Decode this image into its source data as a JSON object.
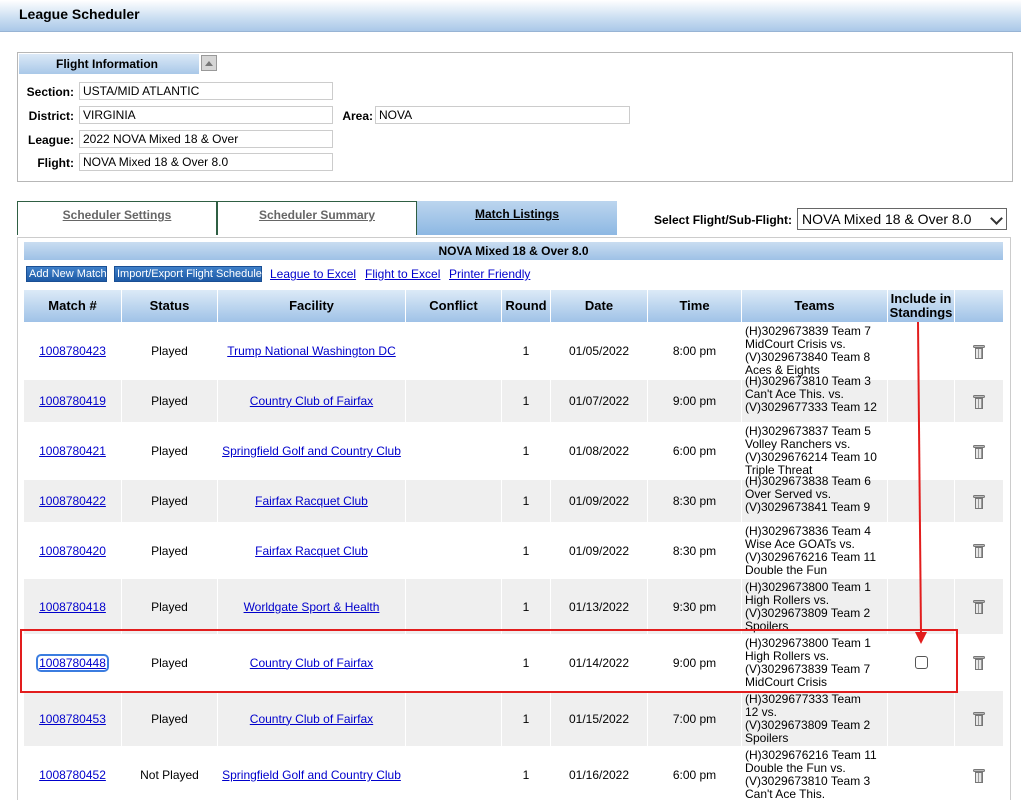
{
  "header": {
    "title": "League Scheduler"
  },
  "flight_info": {
    "tab_label": "Flight Information",
    "fields": {
      "section": {
        "label": "Section:",
        "value": "USTA/MID ATLANTIC"
      },
      "district": {
        "label": "District:",
        "value": "VIRGINIA"
      },
      "area": {
        "label": "Area:",
        "value": "NOVA"
      },
      "league": {
        "label": "League:",
        "value": "2022 NOVA Mixed 18 & Over"
      },
      "flight": {
        "label": "Flight:",
        "value": "NOVA Mixed 18 & Over 8.0"
      }
    }
  },
  "tabs": [
    {
      "label": "Scheduler Settings"
    },
    {
      "label": "Scheduler Summary"
    },
    {
      "label": "Match Listings",
      "active": true
    }
  ],
  "select_flight": {
    "label": "Select Flight/Sub-Flight:",
    "value": "NOVA Mixed 18 & Over 8.0"
  },
  "flight_title": "NOVA Mixed 18 & Over 8.0",
  "actions": {
    "add_new_match": "Add New Match",
    "import_export": "Import/Export Flight Schedule",
    "league_to_excel": "League to Excel",
    "flight_to_excel": "Flight to Excel",
    "printer_friendly": "Printer Friendly"
  },
  "table": {
    "headers": {
      "match": "Match #",
      "status": "Status",
      "facility": "Facility",
      "conflict": "Conflict",
      "round": "Round",
      "date": "Date",
      "time": "Time",
      "teams": "Teams",
      "include": "Include in Standings"
    },
    "rows": [
      {
        "match": "1008780423",
        "status": "Played",
        "facility": "Trump National Washington DC",
        "conflict": "",
        "round": "1",
        "date": "01/05/2022",
        "time": "8:00 pm",
        "teams": [
          "(H)3029673839 Team 7",
          "MidCourt Crisis vs.",
          "(V)3029673840 Team 8",
          "Aces & Eights"
        ]
      },
      {
        "match": "1008780419",
        "status": "Played",
        "facility": "Country Club of Fairfax",
        "conflict": "",
        "round": "1",
        "date": "01/07/2022",
        "time": "9:00 pm",
        "teams": [
          "(H)3029673810 Team 3",
          "Can't Ace This. vs.",
          "(V)3029677333 Team 12",
          ""
        ]
      },
      {
        "match": "1008780421",
        "status": "Played",
        "facility": "Springfield Golf and Country Club",
        "conflict": "",
        "round": "1",
        "date": "01/08/2022",
        "time": "6:00 pm",
        "teams": [
          "(H)3029673837 Team 5",
          "Volley Ranchers vs.",
          "(V)3029676214 Team 10",
          "Triple Threat"
        ]
      },
      {
        "match": "1008780422",
        "status": "Played",
        "facility": "Fairfax Racquet Club",
        "conflict": "",
        "round": "1",
        "date": "01/09/2022",
        "time": "8:30 pm",
        "teams": [
          "(H)3029673838 Team 6",
          "Over Served vs.",
          "(V)3029673841 Team 9",
          ""
        ]
      },
      {
        "match": "1008780420",
        "status": "Played",
        "facility": "Fairfax Racquet Club",
        "conflict": "",
        "round": "1",
        "date": "01/09/2022",
        "time": "8:30 pm",
        "teams": [
          "(H)3029673836 Team 4",
          "Wise Ace GOATs vs.",
          "(V)3029676216 Team 11",
          "Double the Fun"
        ]
      },
      {
        "match": "1008780418",
        "status": "Played",
        "facility": "Worldgate Sport & Health",
        "conflict": "",
        "round": "1",
        "date": "01/13/2022",
        "time": "9:30 pm",
        "teams": [
          "(H)3029673800 Team 1",
          "High Rollers vs.",
          "(V)3029673809 Team 2",
          "Spoilers"
        ]
      },
      {
        "match": "1008780448",
        "status": "Played",
        "facility": "Country Club of Fairfax",
        "conflict": "",
        "round": "1",
        "date": "01/14/2022",
        "time": "9:00 pm",
        "teams": [
          "(H)3029673800 Team 1",
          "High Rollers vs.",
          "(V)3029673839 Team 7",
          "MidCourt Crisis"
        ]
      },
      {
        "match": "1008780453",
        "status": "Played",
        "facility": "Country Club of Fairfax",
        "conflict": "",
        "round": "1",
        "date": "01/15/2022",
        "time": "7:00 pm",
        "teams": [
          "(H)3029677333 Team",
          "12 vs.",
          "(V)3029673809 Team 2",
          "Spoilers"
        ]
      },
      {
        "match": "1008780452",
        "status": "Not Played",
        "facility": "Springfield Golf and Country Club",
        "conflict": "",
        "round": "1",
        "date": "01/16/2022",
        "time": "6:00 pm",
        "teams": [
          "(H)3029676216 Team 11",
          "Double the Fun vs.",
          "(V)3029673810 Team 3",
          "Can't Ace This."
        ]
      }
    ]
  },
  "colors": {
    "highlight_box": "#e21d1d",
    "annotation_arrow": "#e21d1d",
    "link": "#0000cc"
  }
}
